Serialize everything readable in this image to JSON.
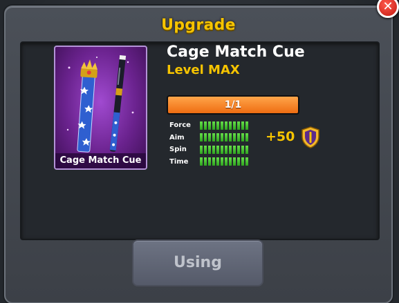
{
  "dialog": {
    "title": "Upgrade",
    "close_icon": "close-icon"
  },
  "cue": {
    "name": "Cage Match Cue",
    "level": "Level MAX",
    "card_label": "Cage Match Cue",
    "image_icon": "cue-image"
  },
  "progress": {
    "text": "1/1",
    "fraction": 1.0,
    "color": "#f3801f"
  },
  "stats": [
    {
      "label": "Force",
      "filled": 12,
      "max": 12
    },
    {
      "label": "Aim",
      "filled": 12,
      "max": 12
    },
    {
      "label": "Spin",
      "filled": 12,
      "max": 12
    },
    {
      "label": "Time",
      "filled": 12,
      "max": 12
    }
  ],
  "bonus": {
    "text": "+50",
    "icon": "shield-icon"
  },
  "action_button": {
    "label": "Using"
  },
  "colors": {
    "accent": "#f6c400",
    "card_purple": "#7a2aa8",
    "stat_green": "#4ccf36"
  }
}
